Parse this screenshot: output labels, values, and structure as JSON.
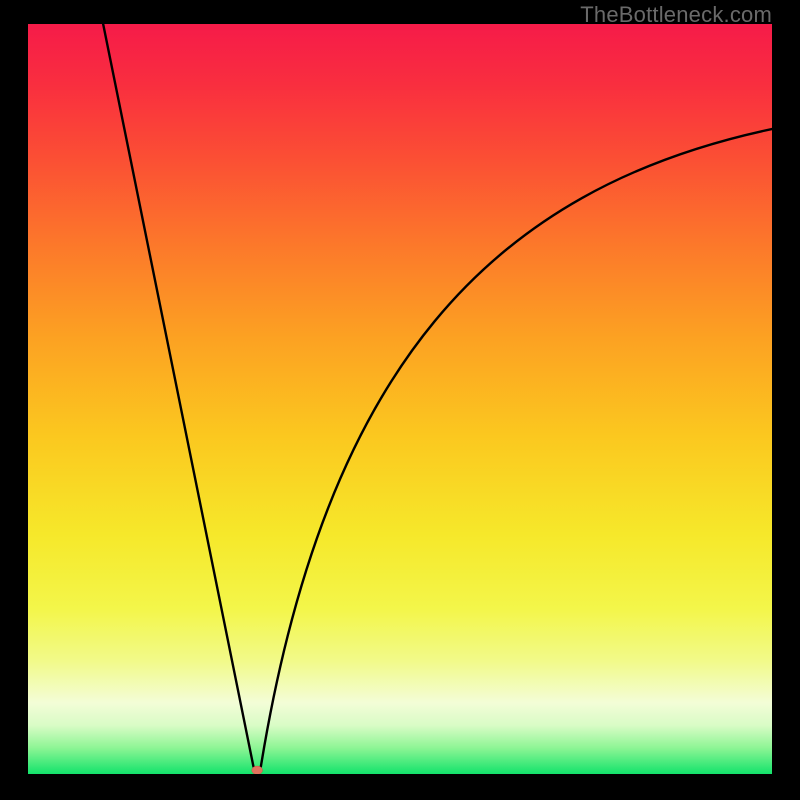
{
  "watermark": "TheBottleneck.com",
  "colors": {
    "black": "#000000",
    "marker_fill": "#e2735e",
    "marker_stroke": "#c55a46",
    "gradient_stops": [
      {
        "offset": 0.0,
        "color": "#f61b49"
      },
      {
        "offset": 0.08,
        "color": "#f92e3f"
      },
      {
        "offset": 0.18,
        "color": "#fb4f34"
      },
      {
        "offset": 0.3,
        "color": "#fc7a2a"
      },
      {
        "offset": 0.42,
        "color": "#fca222"
      },
      {
        "offset": 0.55,
        "color": "#fbc81f"
      },
      {
        "offset": 0.68,
        "color": "#f6e82a"
      },
      {
        "offset": 0.78,
        "color": "#f3f64a"
      },
      {
        "offset": 0.85,
        "color": "#f2fa8a"
      },
      {
        "offset": 0.905,
        "color": "#f3fdd7"
      },
      {
        "offset": 0.935,
        "color": "#d9fcc6"
      },
      {
        "offset": 0.965,
        "color": "#8ef595"
      },
      {
        "offset": 1.0,
        "color": "#13e36b"
      }
    ]
  },
  "chart_data": {
    "type": "line",
    "title": "",
    "xlabel": "",
    "ylabel": "",
    "xlim": [
      0,
      100
    ],
    "ylim": [
      0,
      100
    ],
    "grid": false,
    "legend": false,
    "marker": {
      "x": 30.8,
      "y": 0.5,
      "rx": 5.4,
      "ry": 4.2
    },
    "left_branch": {
      "x_start": 10.1,
      "y_start": 100,
      "x_end": 30.3,
      "y_end": 1.0,
      "ctrl": {
        "x": 22.0,
        "y": 42.0
      }
    },
    "right_branch": {
      "x_start": 31.3,
      "y_start": 1.0,
      "ctrl1": {
        "x": 40.0,
        "y": 54.0
      },
      "ctrl2": {
        "x": 62.0,
        "y": 78.0
      },
      "x_mid": 100.0,
      "y_mid": 86.0
    }
  }
}
